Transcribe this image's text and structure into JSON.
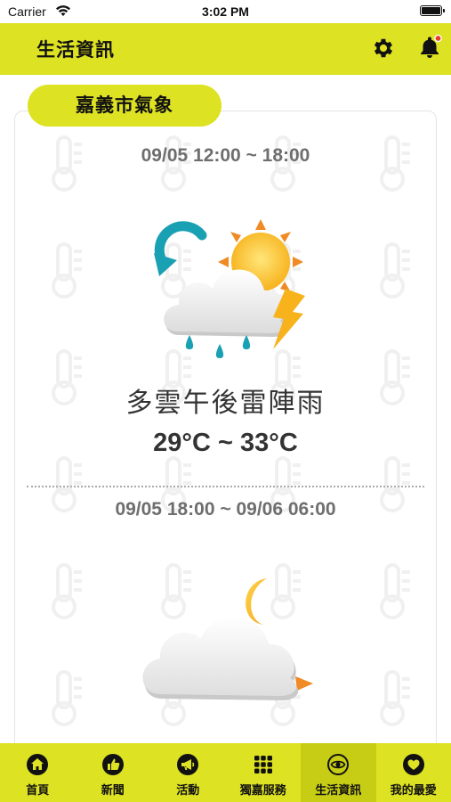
{
  "status_bar": {
    "carrier": "Carrier",
    "time": "3:02 PM",
    "icons": [
      "wifi-icon",
      "battery-icon"
    ]
  },
  "header": {
    "title": "生活資訊",
    "icons": [
      "gear-icon",
      "bell-icon"
    ],
    "notification_dot_color": "#e8392b"
  },
  "weather": {
    "city_label": "嘉義市氣象",
    "periods": [
      {
        "time_range": "09/05 12:00 ~ 18:00",
        "icon": "cloud-sun-rain-thunder-icon",
        "description": "多雲午後雷陣雨",
        "temperature": "29°C ~ 33°C"
      },
      {
        "time_range": "09/05 18:00 ~ 09/06 06:00",
        "icon": "cloud-moon-icon"
      }
    ]
  },
  "bottom_nav": {
    "items": [
      {
        "label": "首頁",
        "icon": "home-icon",
        "active": false
      },
      {
        "label": "新聞",
        "icon": "thumbs-up-icon",
        "active": false
      },
      {
        "label": "活動",
        "icon": "megaphone-icon",
        "active": false
      },
      {
        "label": "獨嘉服務",
        "icon": "grid-icon",
        "active": false
      },
      {
        "label": "生活資訊",
        "icon": "eye-icon",
        "active": true
      },
      {
        "label": "我的最愛",
        "icon": "heart-icon",
        "active": false
      }
    ]
  },
  "colors": {
    "accent": "#dde223",
    "accent_active": "#c7cc14",
    "period_text": "#6e6e6e"
  }
}
